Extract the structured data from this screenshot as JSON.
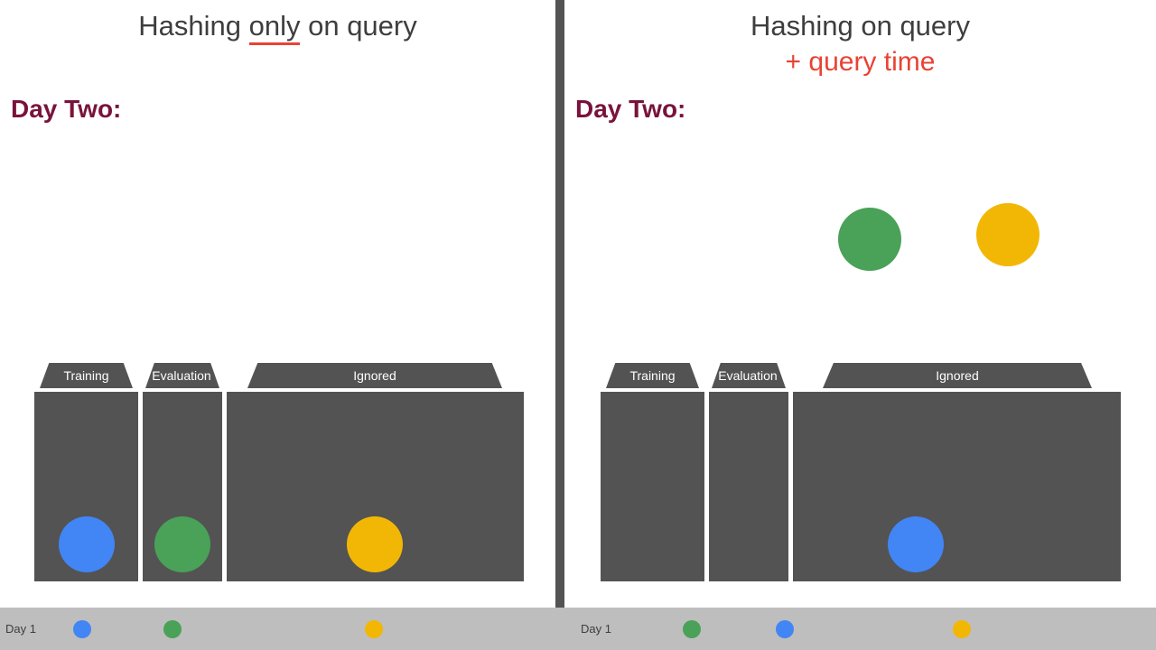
{
  "colors": {
    "blue": "#4285f4",
    "green": "#4aa158",
    "yellow": "#f2b705",
    "grey": "#535353",
    "red": "#e94235",
    "maroon": "#79133b"
  },
  "left": {
    "title_pre": "Hashing ",
    "title_under": "only",
    "title_post": " on query",
    "day": "Day Two:",
    "bins": {
      "training": "Training",
      "evaluation": "Evaluation",
      "ignored": "Ignored"
    },
    "balls": [
      "blue",
      "green",
      "yellow"
    ]
  },
  "right": {
    "title_line1": "Hashing on query",
    "title_line2": "+ query time",
    "day": "Day Two:",
    "bins": {
      "training": "Training",
      "evaluation": "Evaluation",
      "ignored": "Ignored"
    },
    "float_balls": [
      "green",
      "yellow"
    ],
    "bin_ball": "blue"
  },
  "timeline": {
    "label": "Day 1",
    "left_dots": [
      "blue",
      "green",
      "yellow"
    ],
    "right_dots": [
      "green",
      "blue",
      "yellow"
    ]
  }
}
